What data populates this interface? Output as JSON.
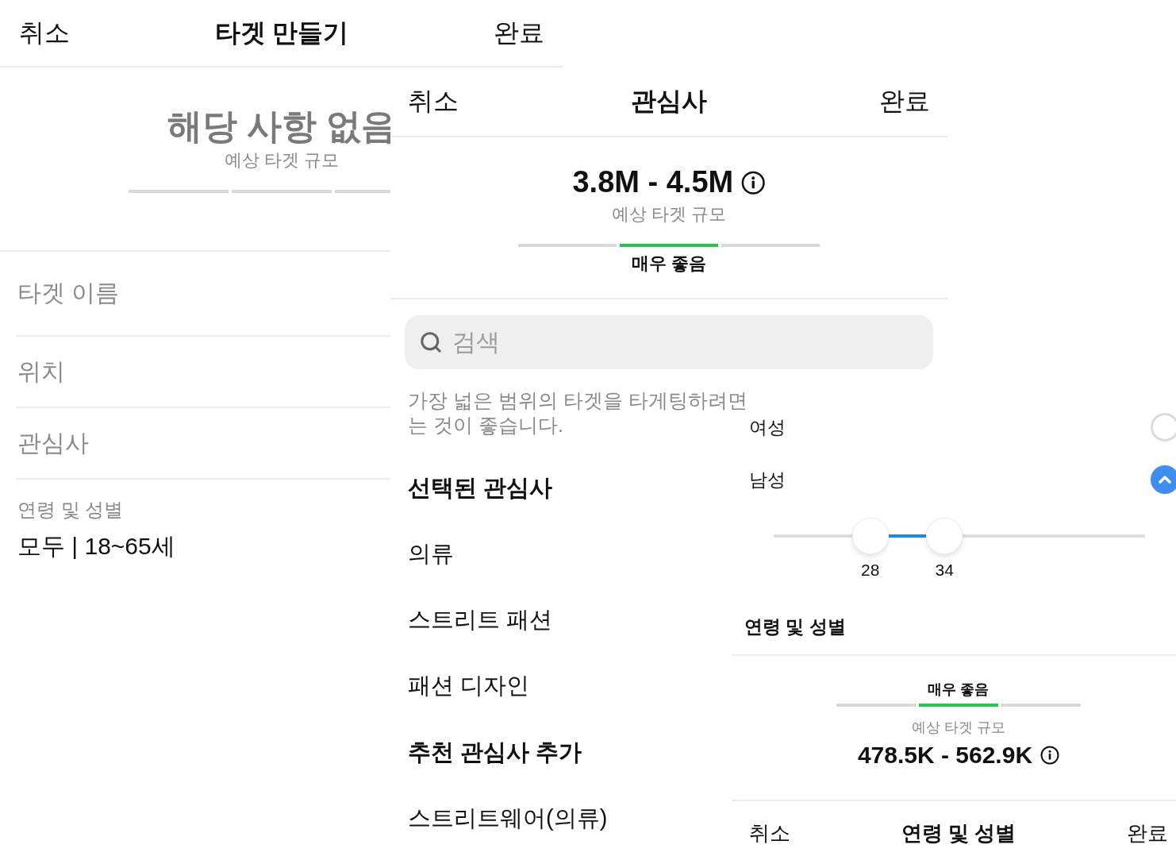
{
  "create_target": {
    "header": {
      "cancel": "취소",
      "title": "타겟 만들기",
      "done": "완료"
    },
    "estimate": {
      "value": "해당 사항 없음",
      "caption": "예상 타겟 규모",
      "segments": [
        {
          "selected": false
        },
        {
          "selected": false
        },
        {
          "selected": false
        }
      ]
    },
    "fields": [
      {
        "label": "타겟 이름"
      },
      {
        "label": "위치"
      },
      {
        "label": "관심사"
      }
    ],
    "age_gender": {
      "label": "연령 및 성별",
      "value": "모두 | 18~65세"
    }
  },
  "interests": {
    "header": {
      "cancel": "취소",
      "title": "관심사",
      "done": "완료"
    },
    "estimate": {
      "value": "3.8M - 4.5M",
      "caption": "예상 타겟 규모",
      "rating": "매우 좋음",
      "segments": [
        {
          "selected": false
        },
        {
          "selected": true
        },
        {
          "selected": false
        }
      ]
    },
    "search": {
      "placeholder": "검색"
    },
    "hint_lines": [
      "가장 넓은 범위의 타겟을 타게팅하려면",
      "는 것이 좋습니다."
    ],
    "sections": [
      {
        "title": "선택된 관심사",
        "items": [
          "의류",
          "스트리트 패션",
          "패션 디자인"
        ]
      },
      {
        "title": "추천 관심사 추가",
        "items": [
          "스트리트웨어(의류)"
        ]
      }
    ]
  },
  "age_gender": {
    "genders": [
      {
        "label": "여성",
        "checked": false
      },
      {
        "label": "남성",
        "checked": true
      }
    ],
    "age_slider": {
      "thumbs": [
        {
          "label": "28",
          "level": 0.26
        },
        {
          "label": "34",
          "level": 0.46
        }
      ]
    },
    "section_title": "연령 및 성별",
    "estimate": {
      "rating": "매우 좋음",
      "segments": [
        {
          "selected": false
        },
        {
          "selected": true
        },
        {
          "selected": false
        }
      ],
      "caption": "예상 타겟 규모",
      "value": "478.5K - 562.9K"
    },
    "header": {
      "cancel": "취소",
      "title": "연령 및 성별",
      "done": "완료"
    }
  }
}
